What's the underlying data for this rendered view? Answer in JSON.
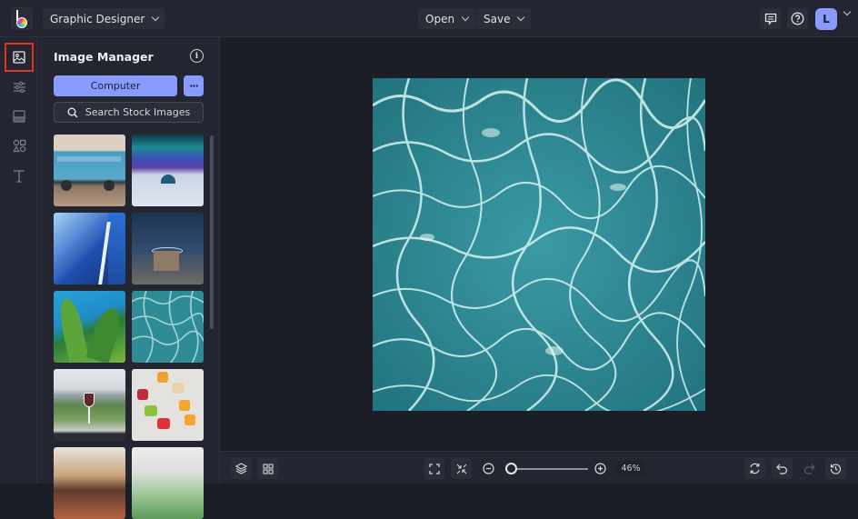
{
  "topbar": {
    "workspace_label": "Graphic Designer",
    "open_label": "Open",
    "save_label": "Save",
    "avatar_initial": "L"
  },
  "rail": {
    "items": [
      {
        "name": "image-manager",
        "icon": "image-icon",
        "active": true
      },
      {
        "name": "adjustments",
        "icon": "sliders-icon",
        "active": false
      },
      {
        "name": "layout",
        "icon": "layout-icon",
        "active": false
      },
      {
        "name": "graphics",
        "icon": "shapes-icon",
        "active": false
      },
      {
        "name": "text",
        "icon": "text-icon",
        "active": false
      }
    ]
  },
  "panel": {
    "title": "Image Manager",
    "info_glyph": "i",
    "computer_label": "Computer",
    "more_label": "···",
    "search_label": "Search Stock Images",
    "thumbnails": [
      {
        "name": "blue-van"
      },
      {
        "name": "aurora-igloo"
      },
      {
        "name": "glass-skyscraper"
      },
      {
        "name": "desert-rock-night"
      },
      {
        "name": "banana-leaves"
      },
      {
        "name": "pool-water"
      },
      {
        "name": "wine-vineyard"
      },
      {
        "name": "fruit-toasts"
      },
      {
        "name": "cheese-board"
      },
      {
        "name": "salad-bowl"
      }
    ]
  },
  "canvas": {
    "image": "pool-water"
  },
  "bottombar": {
    "zoom_percent": "46%",
    "zoom_value": 46
  },
  "colors": {
    "accent": "#8a9bff",
    "highlight": "#e5311f",
    "background": "#1b1d27",
    "surface": "#232530"
  }
}
